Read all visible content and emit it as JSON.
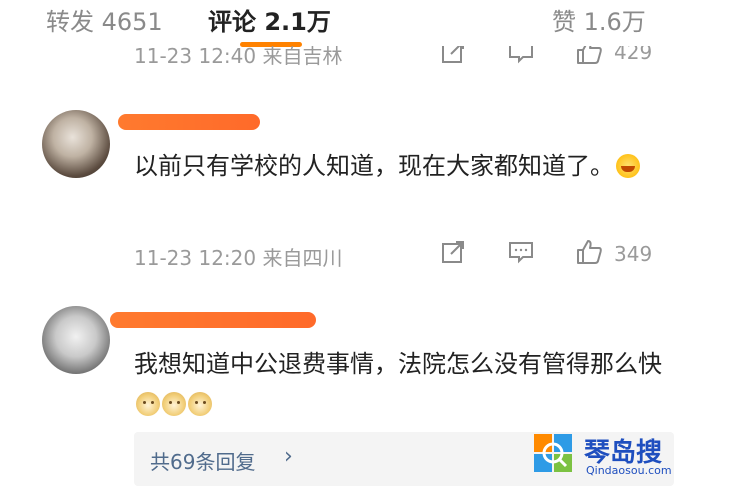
{
  "tabs": {
    "repost": "转发 4651",
    "comment": "评论 2.1万",
    "like": "赞 1.6万",
    "accent_color": "#ff8200"
  },
  "previous_comment": {
    "meta": "11-23 12:40 来自吉林",
    "likes": "429"
  },
  "comments": [
    {
      "text": "以前只有学校的人知道，现在大家都知道了。",
      "meta": "11-23 12:20 来自四川",
      "likes": "349"
    },
    {
      "text": "我想知道中公退费事情，法院怎么没有管得那么快",
      "replies_label": "共69条回复"
    }
  ],
  "icons": {
    "share": "share-icon",
    "comment": "comment-icon",
    "like": "thumbs-up-icon",
    "chevron": "chevron-right-icon"
  },
  "watermark": {
    "text": "琴岛搜",
    "url": "Qindaosou.com"
  }
}
